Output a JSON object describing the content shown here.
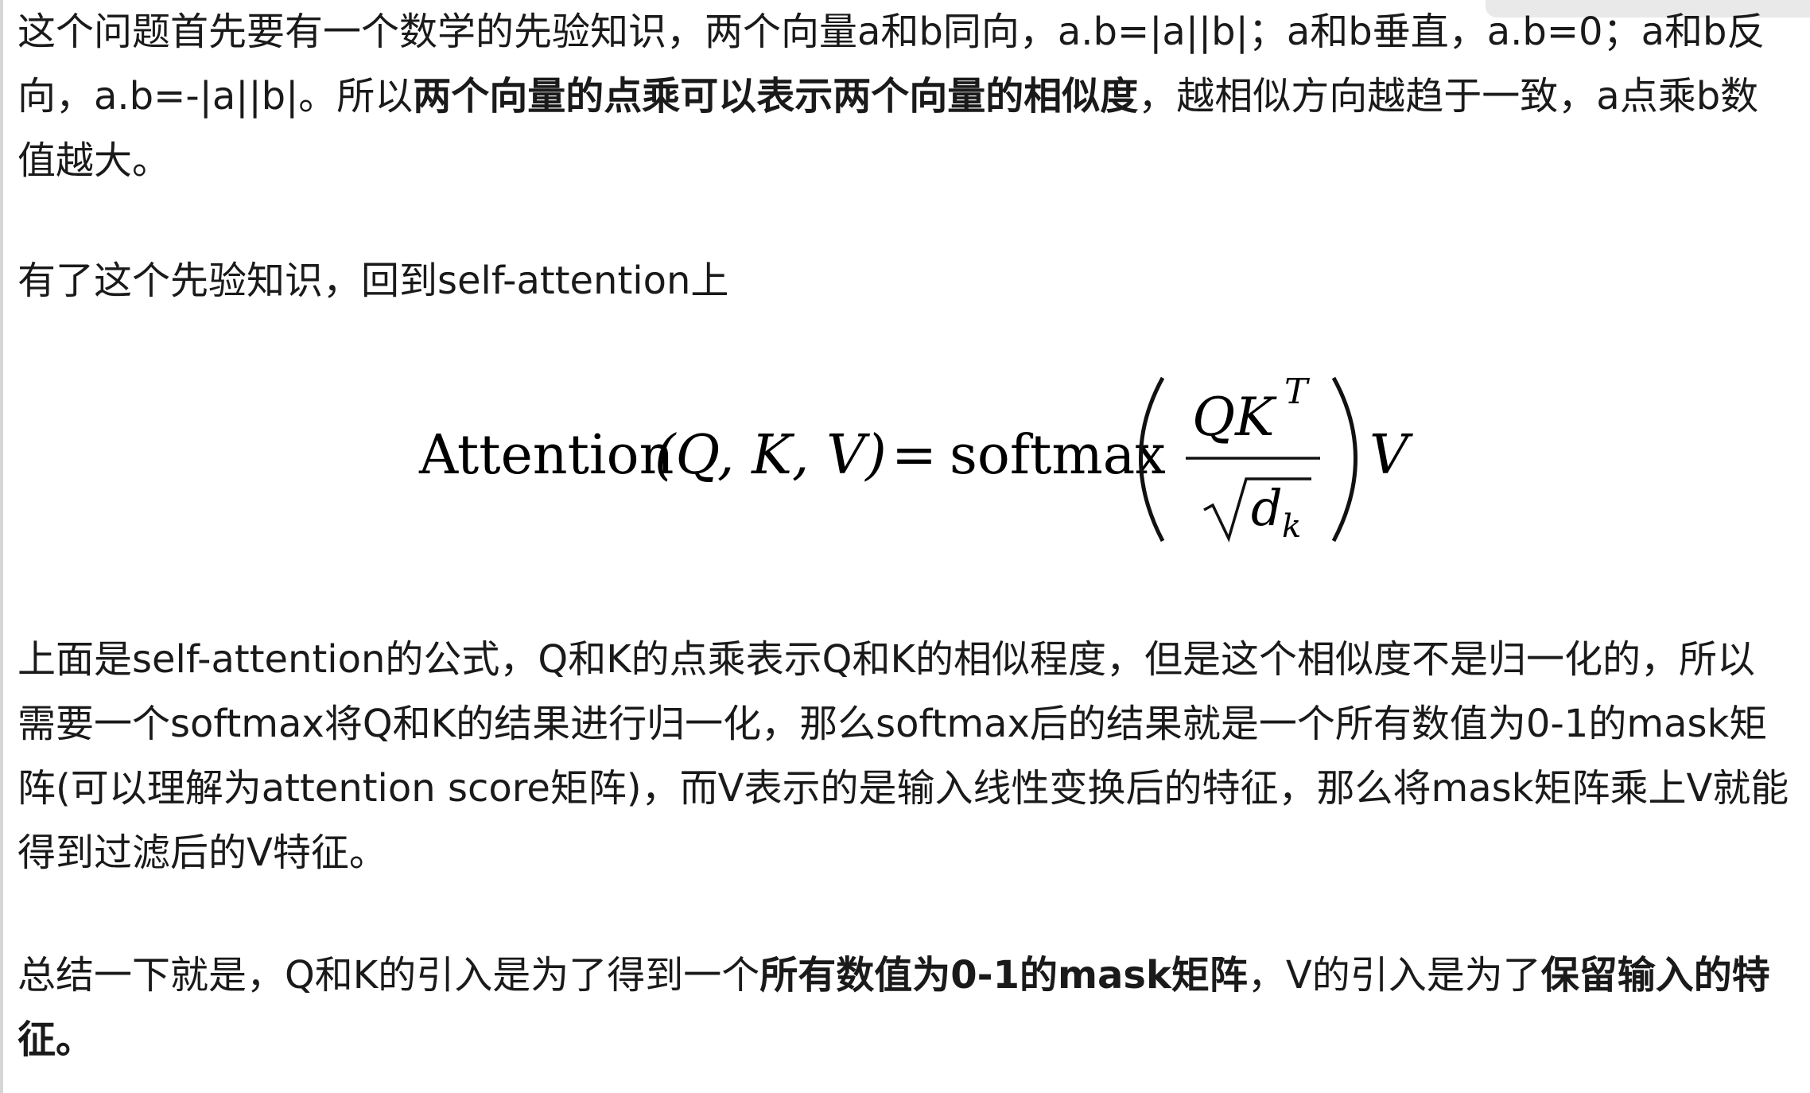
{
  "paragraphs": {
    "p1": [
      {
        "t": "这个问题首先要有一个数学的先验知识，两个向量a和b同向，a.b=|a||b|；a和b垂直，a.b=0；a和b反向，a.b=-|a||b|。所以",
        "b": false
      },
      {
        "t": "两个向量的点乘可以表示两个向量的相似度",
        "b": true
      },
      {
        "t": "，越相似方向越趋于一致，a点乘b数值越大。",
        "b": false
      }
    ],
    "p2": "有了这个先验知识，回到self-attention上",
    "p3": "上面是self-attention的公式，Q和K的点乘表示Q和K的相似程度，但是这个相似度不是归一化的，所以需要一个softmax将Q和K的结果进行归一化，那么softmax后的结果就是一个所有数值为0-1的mask矩阵(可以理解为attention score矩阵)，而V表示的是输入线性变换后的特征，那么将mask矩阵乘上V就能得到过滤后的V特征。",
    "p4": [
      {
        "t": "总结一下就是，Q和K的引入是为了得到一个",
        "b": false
      },
      {
        "t": "所有数值为0-1的mask矩阵",
        "b": true
      },
      {
        "t": "，V的引入是为了",
        "b": false
      },
      {
        "t": "保留输入的特征。",
        "b": true
      }
    ]
  },
  "formula": {
    "lhs_name": "Attention",
    "lhs_args": "(Q, K, V)",
    "equals": "=",
    "func": "softmax",
    "numerator": "QK",
    "numerator_sup": "T",
    "denominator": "d",
    "denominator_sub": "k",
    "trailing": "V"
  }
}
